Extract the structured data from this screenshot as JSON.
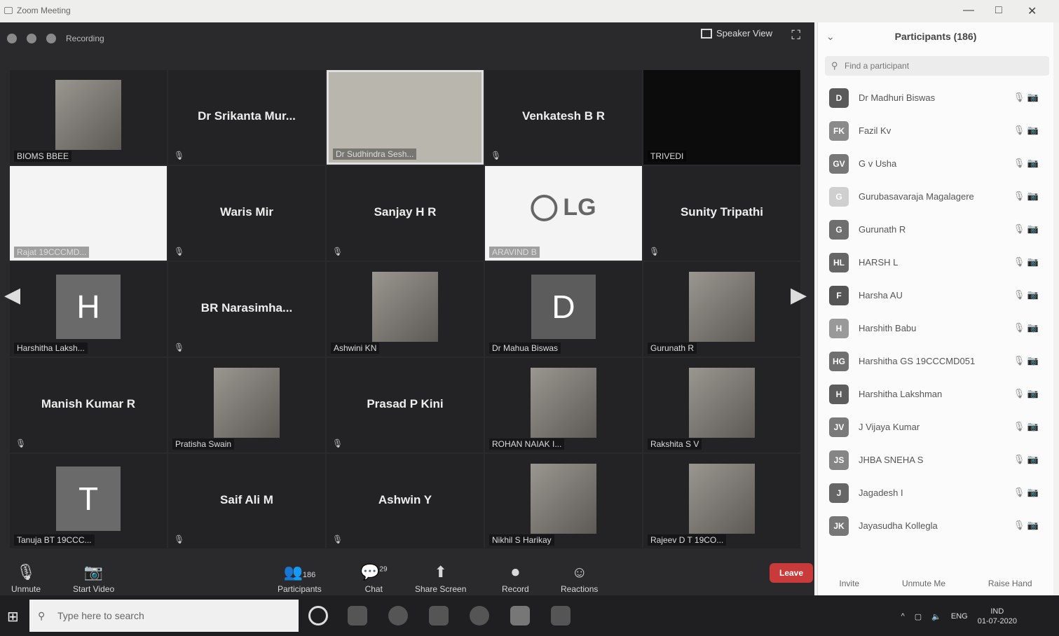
{
  "window": {
    "title": "Zoom Meeting",
    "minimize": "—",
    "maximize": "□",
    "close": "✕"
  },
  "topbar": {
    "recording": "Recording",
    "speaker_view": "Speaker View",
    "fullscreen": "⛶"
  },
  "tiles": [
    {
      "kind": "photo",
      "label": "BIOMS BBEE",
      "mic": false
    },
    {
      "kind": "name",
      "name": "Dr Srikanta Mur...",
      "mic": true
    },
    {
      "kind": "active",
      "label": "Dr Sudhindra Sesh...",
      "mic": false
    },
    {
      "kind": "name",
      "name": "Venkatesh B R",
      "mic": true
    },
    {
      "kind": "dark",
      "label": "TRIVEDI",
      "mic": true
    },
    {
      "kind": "white",
      "label": "Rajat 19CCCMD...",
      "mic": true
    },
    {
      "kind": "name",
      "name": "Waris Mir",
      "mic": true
    },
    {
      "kind": "name",
      "name": "Sanjay H R",
      "mic": true
    },
    {
      "kind": "lg",
      "label": "ARAVIND B",
      "mic": false
    },
    {
      "kind": "name",
      "name": "Sunity Tripathi",
      "mic": true
    },
    {
      "kind": "letter",
      "letter": "H",
      "color": "#6a6a6a",
      "label": "Harshitha Laksh...",
      "mic": false
    },
    {
      "kind": "name",
      "name": "BR Narasimha...",
      "mic": true
    },
    {
      "kind": "photo",
      "label": "Ashwini KN",
      "mic": true
    },
    {
      "kind": "letter",
      "letter": "D",
      "color": "#5c5c5c",
      "label": "Dr Mahua Biswas",
      "mic": true
    },
    {
      "kind": "photo",
      "label": "Gurunath R",
      "mic": true
    },
    {
      "kind": "name",
      "name": "Manish Kumar R",
      "mic": true
    },
    {
      "kind": "photo",
      "label": "Pratisha Swain",
      "mic": true
    },
    {
      "kind": "name",
      "name": "Prasad P Kini",
      "mic": true
    },
    {
      "kind": "photo",
      "label": "ROHAN NAIAK I...",
      "mic": true
    },
    {
      "kind": "photo",
      "label": "Rakshita S V",
      "mic": true
    },
    {
      "kind": "letter",
      "letter": "T",
      "color": "#6a6a6a",
      "label": "Tanuja BT 19CCC...",
      "mic": true
    },
    {
      "kind": "name",
      "name": "Saif Ali M",
      "mic": true
    },
    {
      "kind": "name",
      "name": "Ashwin Y",
      "mic": true
    },
    {
      "kind": "photo",
      "label": "Nikhil S Harikay",
      "mic": true
    },
    {
      "kind": "photo",
      "label": "Rajeev D T 19CO...",
      "mic": true
    }
  ],
  "toolbar": {
    "unmute": "Unmute",
    "start_video": "Start Video",
    "participants": "Participants",
    "participants_count": "186",
    "chat": "Chat",
    "chat_badge": "29",
    "share_screen": "Share Screen",
    "record": "Record",
    "reactions": "Reactions",
    "leave": "Leave"
  },
  "panel": {
    "title": "Participants (186)",
    "search_placeholder": "Find a participant",
    "participants": [
      {
        "initials": "D",
        "name": "Dr Madhuri Biswas",
        "color": "#5a5a5a"
      },
      {
        "initials": "FK",
        "name": "Fazil Kv",
        "color": "#8a8a8a"
      },
      {
        "initials": "GV",
        "name": "G v Usha",
        "color": "#777777"
      },
      {
        "initials": "G",
        "name": "Gurubasavaraja Magalagere",
        "color": "#cfcfcf"
      },
      {
        "initials": "G",
        "name": "Gurunath R",
        "color": "#6e6e6e"
      },
      {
        "initials": "HL",
        "name": "HARSH L",
        "color": "#666666"
      },
      {
        "initials": "F",
        "name": "Harsha AU",
        "color": "#555555"
      },
      {
        "initials": "H",
        "name": "Harshith Babu",
        "color": "#999999"
      },
      {
        "initials": "HG",
        "name": "Harshitha GS 19CCCMD051",
        "color": "#707070"
      },
      {
        "initials": "H",
        "name": "Harshitha Lakshman",
        "color": "#5d5d5d"
      },
      {
        "initials": "JV",
        "name": "J Vijaya Kumar",
        "color": "#7a7a7a"
      },
      {
        "initials": "JS",
        "name": "JHBA SNEHA S",
        "color": "#858585"
      },
      {
        "initials": "J",
        "name": "Jagadesh I",
        "color": "#666666"
      },
      {
        "initials": "JK",
        "name": "Jayasudha Kollegla",
        "color": "#777777"
      }
    ],
    "footer": {
      "invite": "Invite",
      "unmute_me": "Unmute Me",
      "raise_hand": "Raise Hand"
    }
  },
  "taskbar": {
    "search_placeholder": "Type here to search",
    "lang": "ENG",
    "region": "IND",
    "date": "01-07-2020"
  }
}
